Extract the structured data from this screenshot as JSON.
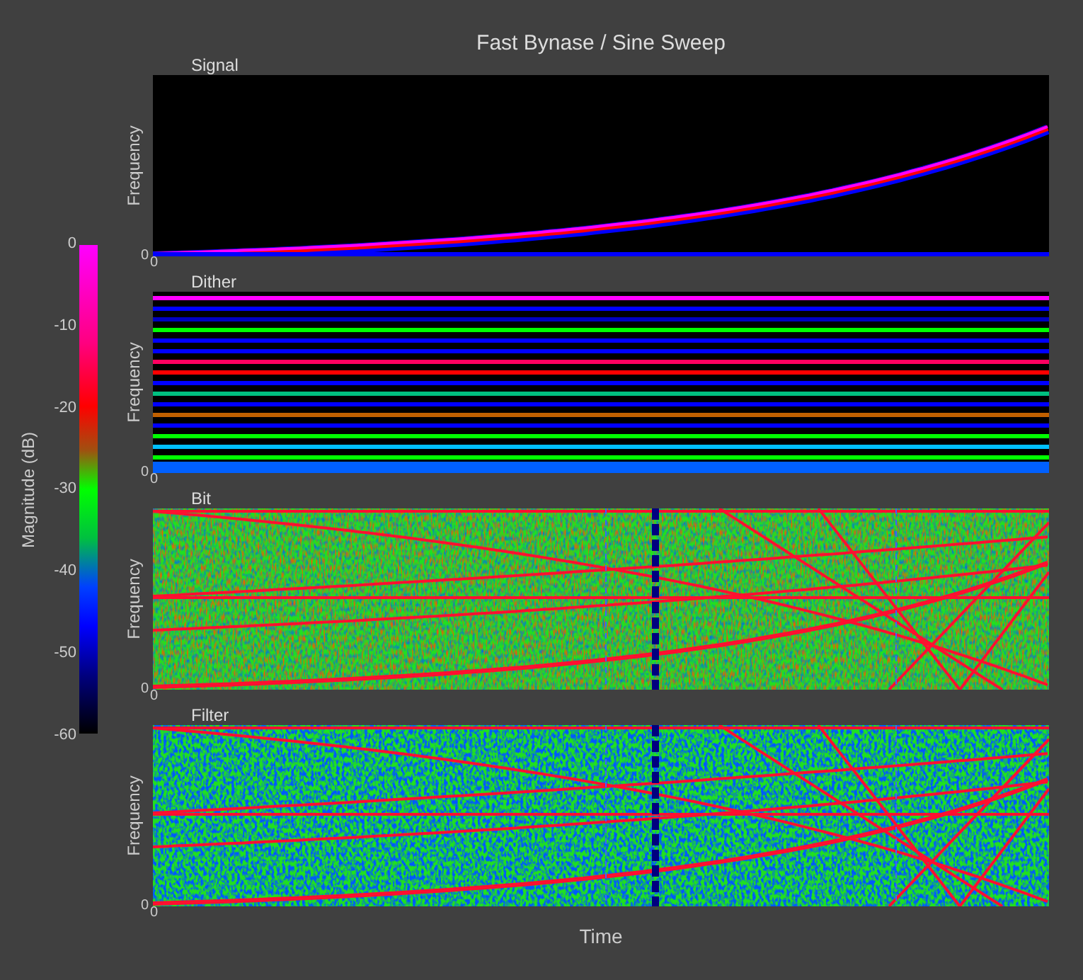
{
  "title": "Fast Bynase / Sine Sweep",
  "colorbar": {
    "label": "Magnitude (dB)",
    "ticks": [
      "0",
      "-10",
      "-20",
      "-30",
      "-40",
      "-50",
      "-60"
    ]
  },
  "panels": [
    {
      "title": "Signal",
      "kind": "sweep",
      "ylabel": "Frequency",
      "y_tick": "0",
      "x_tick": "0"
    },
    {
      "title": "Dither",
      "kind": "stripes",
      "ylabel": "Frequency",
      "y_tick": "0",
      "x_tick": "0"
    },
    {
      "title": "Bit",
      "kind": "noise",
      "ylabel": "Frequency",
      "y_tick": "0",
      "x_tick": "0"
    },
    {
      "title": "Filter",
      "kind": "filtered",
      "ylabel": "Frequency",
      "y_tick": "0",
      "x_tick": "0"
    }
  ],
  "xlabel": "Time"
}
